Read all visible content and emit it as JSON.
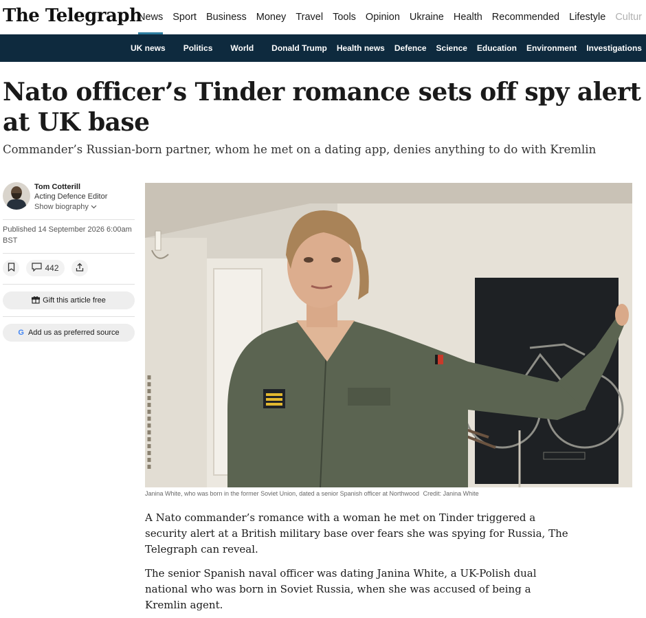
{
  "header": {
    "logo": "The Telegraph",
    "primary_nav": [
      "News",
      "Sport",
      "Business",
      "Money",
      "Travel",
      "Tools",
      "Opinion",
      "Ukraine",
      "Health",
      "Recommended",
      "Lifestyle",
      "Cultur"
    ],
    "active_index": 0,
    "secondary_nav": [
      "UK news",
      "Politics",
      "World",
      "Donald Trump",
      "Health news",
      "Defence",
      "Science",
      "Education",
      "Environment",
      "Investigations"
    ]
  },
  "article": {
    "headline": "Nato officer’s Tinder romance sets off spy alert at UK base",
    "standfirst": "Commander’s Russian-born partner, whom he met on a dating app, denies anything to do with Kremlin",
    "author": {
      "name": "Tom Cotterill",
      "role": "Acting Defence Editor",
      "show_bio": "Show biography"
    },
    "published": "Published 14 September 2026 6:00am BST",
    "comment_count": "442",
    "gift_label": "Gift this article free",
    "preferred_source_label": "Add us as preferred source",
    "image_caption": "Janina White, who was born in the former Soviet Union, dated a senior Spanish officer at Northwood",
    "image_credit": "Credit: Janina White",
    "paragraphs": [
      "A Nato commander’s romance with a woman he met on Tinder triggered a security alert at a British military base over fears she was spying for Russia, The Telegraph can reveal.",
      "The senior Spanish naval officer was dating Janina White, a UK-Polish dual national who was born in Soviet Russia, when she was accused of being a Kremlin agent."
    ]
  },
  "colors": {
    "subnav_bg": "#0e2a3e",
    "active_underline": "#2e7da0",
    "google_blue": "#4285f4"
  },
  "icons": [
    "bookmark-icon",
    "comment-icon",
    "share-icon",
    "gift-icon",
    "google-icon",
    "chevron-down-icon"
  ]
}
